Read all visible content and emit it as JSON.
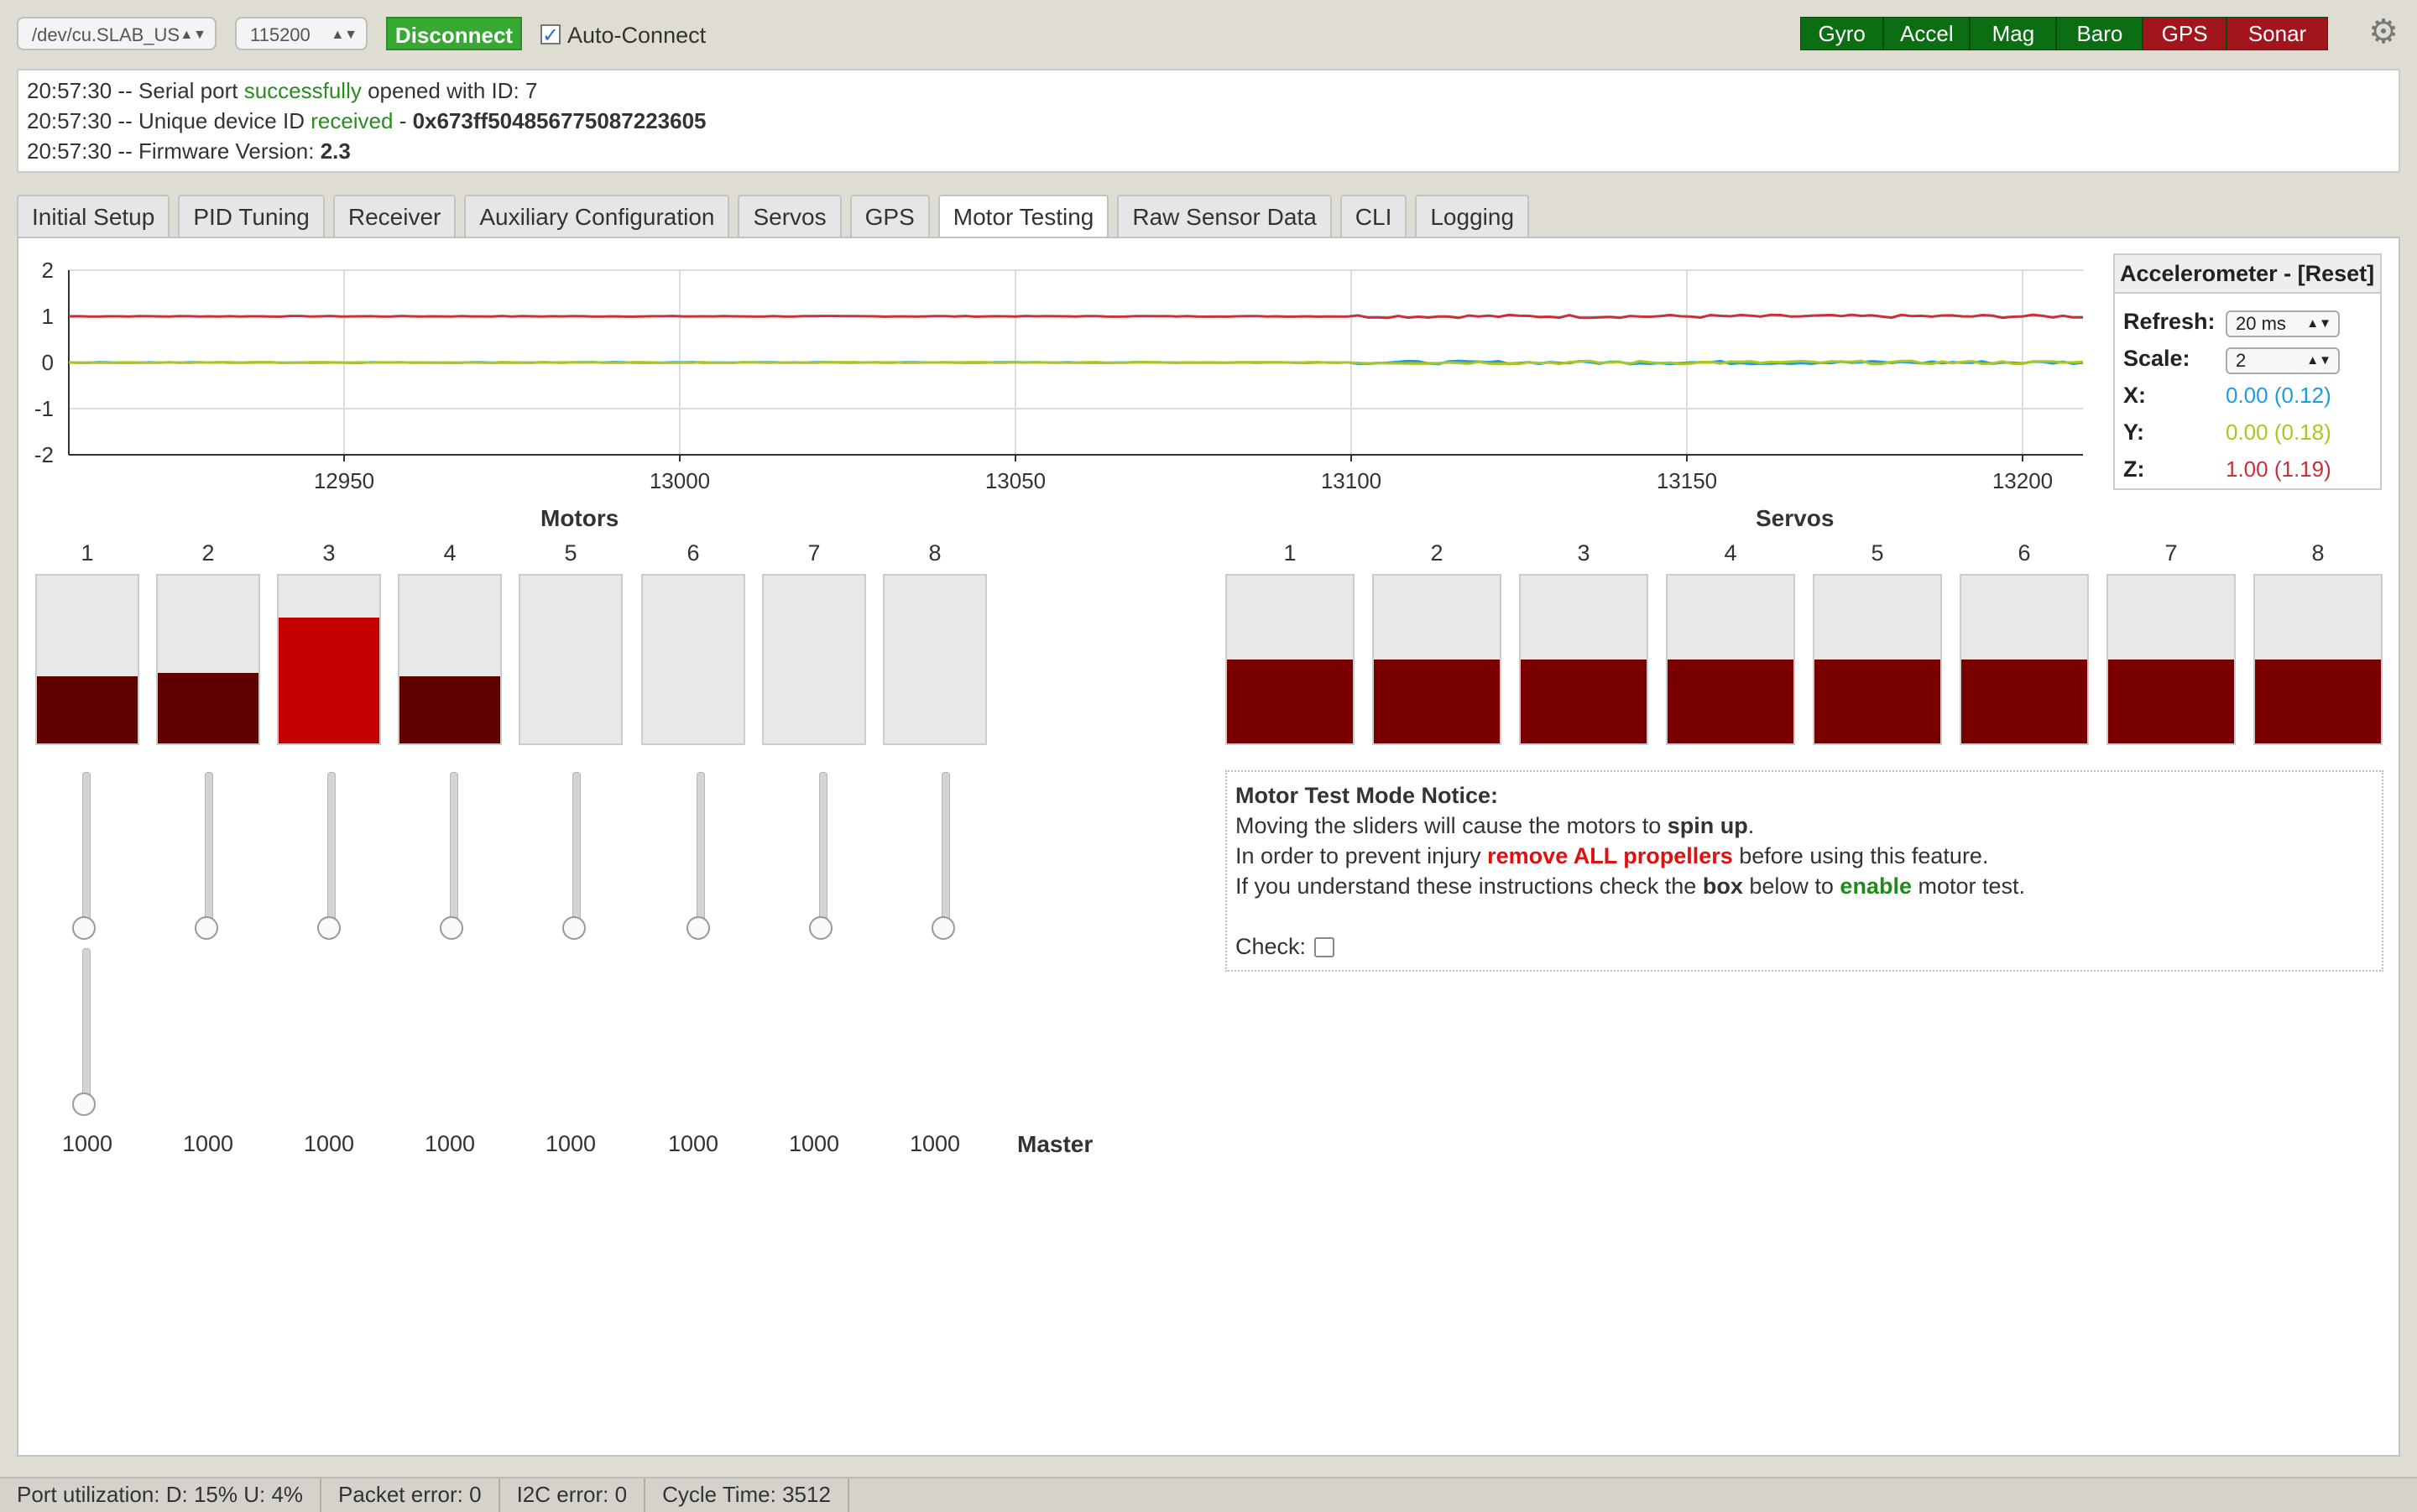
{
  "topbar": {
    "port": "/dev/cu.SLAB_US",
    "baud": "115200",
    "disconnect_label": "Disconnect",
    "autoconnect_label": "Auto-Connect",
    "sensors": [
      {
        "label": "Gyro",
        "state": "on"
      },
      {
        "label": "Accel",
        "state": "on"
      },
      {
        "label": "Mag",
        "state": "on"
      },
      {
        "label": "Baro",
        "state": "on"
      },
      {
        "label": "GPS",
        "state": "off"
      },
      {
        "label": "Sonar",
        "state": "off"
      }
    ]
  },
  "log": {
    "l1_time": "20:57:30 -- Serial port ",
    "l1_ok": "successfully",
    "l1_rest": " opened with ID: 7",
    "l2_time": "20:57:30 -- Unique device ID ",
    "l2_ok": "received",
    "l2_dash": " - ",
    "l2_id": "0x673ff504856775087223605",
    "l3_time": "20:57:30 -- Firmware Version: ",
    "l3_ver": "2.3"
  },
  "tabs": [
    "Initial Setup",
    "PID Tuning",
    "Receiver",
    "Auxiliary Configuration",
    "Servos",
    "GPS",
    "Motor Testing",
    "Raw Sensor Data",
    "CLI",
    "Logging"
  ],
  "active_tab": "Motor Testing",
  "accelerometer": {
    "title": "Accelerometer - [Reset]",
    "refresh_label": "Refresh:",
    "refresh_value": "20 ms",
    "scale_label": "Scale:",
    "scale_value": "2",
    "x_label": "X:",
    "x_value": "0.00 (0.12)",
    "y_label": "Y:",
    "y_value": "0.00 (0.18)",
    "z_label": "Z:",
    "z_value": "1.00 (1.19)",
    "x_color": "#1a9ee0",
    "y_color": "#a8c81e",
    "z_color": "#c8303a"
  },
  "chart_data": {
    "type": "line",
    "x_ticks": [
      12950,
      13000,
      13050,
      13100,
      13150,
      13200
    ],
    "y_ticks": [
      2,
      1,
      0,
      -1,
      -2
    ],
    "xlim": [
      12909,
      13209
    ],
    "ylim": [
      -2,
      2
    ],
    "grid": true,
    "series": [
      {
        "color": "#c8303a",
        "level": 1.0
      },
      {
        "color": "#1a9ee0",
        "level": 0.0
      },
      {
        "color": "#a8c81e",
        "level": 0.0
      }
    ]
  },
  "motors": {
    "title": "Motors",
    "labels": [
      "1",
      "2",
      "3",
      "4",
      "5",
      "6",
      "7",
      "8"
    ],
    "levels": [
      0.4,
      0.42,
      0.75,
      0.4,
      0,
      0,
      0,
      0
    ],
    "highlight": [
      false,
      false,
      true,
      false,
      false,
      false,
      false,
      false
    ],
    "values": [
      "1000",
      "1000",
      "1000",
      "1000",
      "1000",
      "1000",
      "1000",
      "1000"
    ],
    "master_label": "Master"
  },
  "servos": {
    "title": "Servos",
    "labels": [
      "1",
      "2",
      "3",
      "4",
      "5",
      "6",
      "7",
      "8"
    ],
    "levels": [
      0.5,
      0.5,
      0.5,
      0.5,
      0.5,
      0.5,
      0.5,
      0.5
    ]
  },
  "notice": {
    "title": "Motor Test Mode Notice:",
    "l1a": "Moving the sliders will cause the motors to ",
    "l1b": "spin up",
    "l1c": ".",
    "l2a": "In order to prevent injury ",
    "l2b": "remove ALL propellers",
    "l2c": " before using this feature.",
    "l3a": "If you understand these instructions check the ",
    "l3b": "box",
    "l3c": " below to ",
    "l3d": "enable",
    "l3e": " motor test.",
    "check_label": "Check:"
  },
  "status": {
    "port_util": "Port utilization: D: 15% U: 4%",
    "packet_error": "Packet error: 0",
    "i2c_error": "I2C error: 0",
    "cycle_time": "Cycle Time: 3512"
  }
}
